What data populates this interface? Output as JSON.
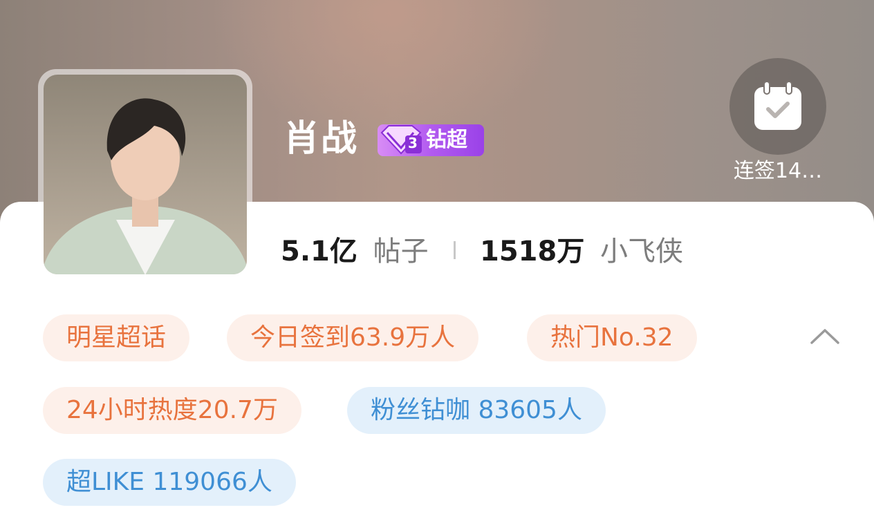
{
  "topic": {
    "name": "肖战",
    "badge_level": "3",
    "badge_label": "钻超"
  },
  "checkin": {
    "label": "连签14…",
    "icon": "calendar-check-icon"
  },
  "stats": {
    "posts_value": "5.1亿",
    "posts_label": "帖子",
    "fans_value": "1518万",
    "fans_label": "小飞侠"
  },
  "tags": [
    {
      "text": "明星超话",
      "style": "orange"
    },
    {
      "text": "今日签到63.9万人",
      "style": "orange"
    },
    {
      "text": "热门No.32",
      "style": "orange"
    },
    {
      "text": "24小时热度20.7万",
      "style": "orange"
    },
    {
      "text": "粉丝钻咖 83605人",
      "style": "blue"
    },
    {
      "text": "超LIKE 119066人",
      "style": "blue"
    }
  ],
  "colors": {
    "tag_orange_bg": "#fdf0ea",
    "tag_orange_text": "#e8733e",
    "tag_blue_bg": "#e3f0fb",
    "tag_blue_text": "#3f8fd4",
    "badge_purple": "#b25bef"
  },
  "icons": {
    "collapse": "chevron-up-icon",
    "badge": "diamond-icon"
  }
}
